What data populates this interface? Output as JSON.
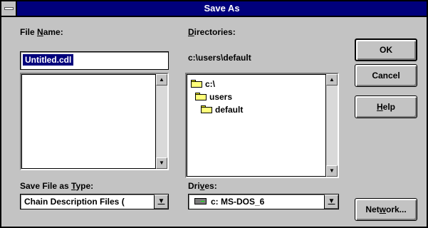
{
  "window": {
    "title": "Save As"
  },
  "file_name": {
    "label_pre": "File ",
    "label_key": "N",
    "label_post": "ame:",
    "value": "Untitled.cdl"
  },
  "directories": {
    "label_key": "D",
    "label_post": "irectories:",
    "current_path": "c:\\users\\default",
    "tree": [
      "c:\\",
      "users",
      "default"
    ]
  },
  "save_type": {
    "label_pre": "Save File as ",
    "label_key": "T",
    "label_post": "ype:",
    "value": "Chain Description Files ("
  },
  "drives": {
    "label_pre": "Dri",
    "label_key": "v",
    "label_post": "es:",
    "value": "c: MS-DOS_6"
  },
  "buttons": {
    "ok": "OK",
    "cancel": "Cancel",
    "help_key": "H",
    "help_post": "elp",
    "network_pre": "Net",
    "network_key": "w",
    "network_post": "ork..."
  },
  "glyphs": {
    "scroll_up": "▲",
    "scroll_down": "▼",
    "dropdown": "▼"
  },
  "icons": {
    "system_menu": "system-menu-icon",
    "folder": "folder-icon",
    "drive": "hard-drive-icon"
  }
}
